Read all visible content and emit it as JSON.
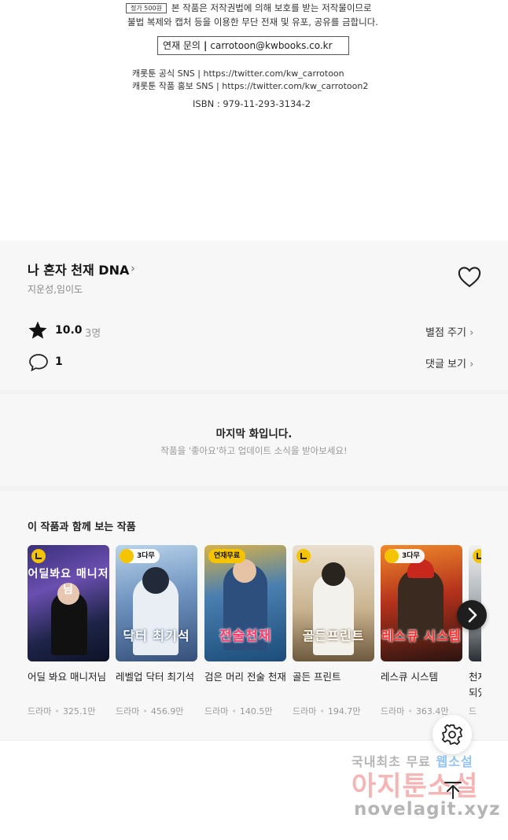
{
  "copyright": {
    "price": "정가 500원",
    "line1": "본 작품은 저작권법에 의해 보호를 받는 저작물이므로",
    "line2": "불법 복제와 캡처 등을 이용한 무단 전재 및 유포, 공유를 금합니다.",
    "contact_label": "연재 문의",
    "contact_email": "carrotoon@kwbooks.co.kr",
    "sns_official": "캐롯툰 공식 SNS | https://twitter.com/kw_carrotoon",
    "sns_promo": "캐롯툰 작품 홍보 SNS | https://twitter.com/kw_carrotoon2",
    "isbn": "ISBN : 979-11-293-3134-2"
  },
  "work": {
    "title": "나 혼자 천재 DNA",
    "authors": "지운성,임이도",
    "rating": "10.0",
    "rating_count": "3명",
    "rate_link": "별점 주기",
    "comment_count": "1",
    "comment_link": "댓글 보기"
  },
  "last_episode": {
    "title": "마지막 화입니다.",
    "subtitle": "작품을 '좋아요'하고 업데이트 소식을 받아보세요!"
  },
  "recommendations": {
    "title": "이 작품과 함께 보는 작품",
    "items": [
      {
        "title": "어딜 봐요 매니저님",
        "genre": "드라마",
        "views": "325.1만",
        "badge": "",
        "cover_text": "어딜봐요 매니저님"
      },
      {
        "title": "레벨업 닥터 최기석",
        "genre": "드라마",
        "views": "456.9만",
        "badge": "3다무",
        "cover_text": "닥터 최기석"
      },
      {
        "title": "검은 머리 전술 천재",
        "genre": "드라마",
        "views": "140.5만",
        "badge": "연재무료",
        "cover_text": "전술천재"
      },
      {
        "title": "골든 프린트",
        "genre": "드라마",
        "views": "194.7만",
        "badge": "",
        "cover_text": "골든프린트"
      },
      {
        "title": "레스큐 시스템",
        "genre": "드라마",
        "views": "363.4만",
        "badge": "3다무",
        "cover_text": "레스큐 시스템"
      },
      {
        "title": "천재 되었",
        "genre": "드",
        "views": "",
        "badge": "",
        "cover_text": ""
      }
    ]
  },
  "watermark": {
    "line1a": "국내최초 무료",
    "line1b": "웹소설",
    "line2": "아지툰소설",
    "line3": "novelagit.xyz"
  },
  "icons": {
    "heart": "heart-outline-icon",
    "star": "star-filled-icon",
    "comment": "speech-bubble-icon",
    "next": "chevron-right-icon",
    "gear": "gear-icon",
    "top": "arrow-up-icon"
  },
  "colors": {
    "badge_yellow": "#f5c400",
    "background_gray": "#f7f7f7",
    "watermark_red": "#eb5a5a"
  }
}
